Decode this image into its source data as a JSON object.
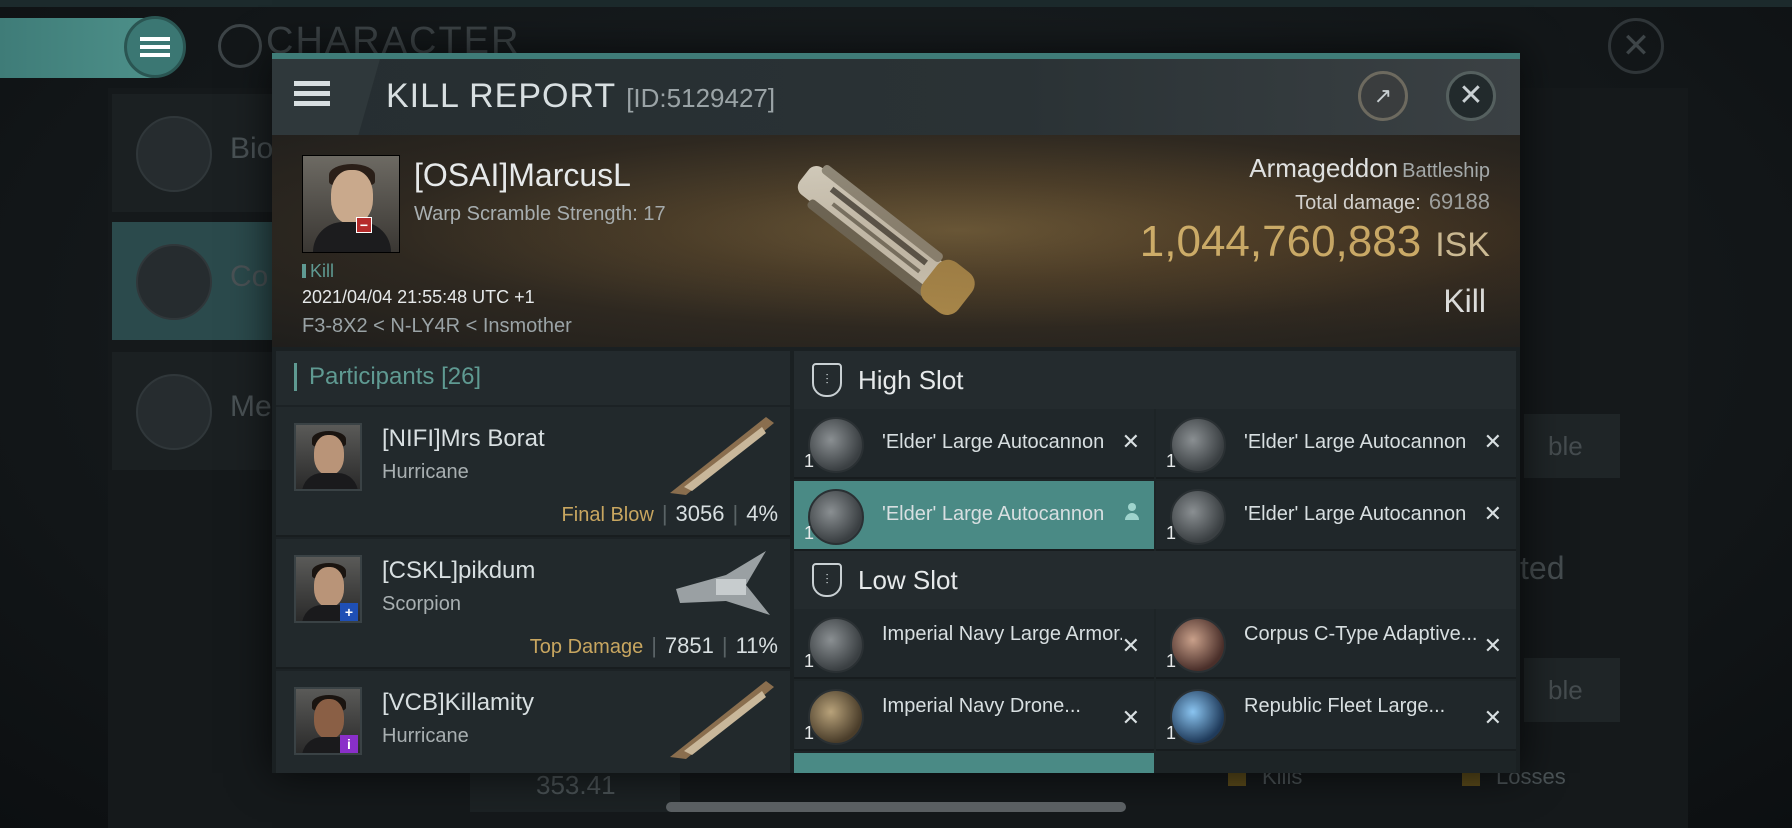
{
  "background": {
    "title": "CHARACTER",
    "side_items": [
      {
        "label": "Bio"
      },
      {
        "label": "Co"
      },
      {
        "label": "Me"
      }
    ],
    "right_buttons": [
      "ble",
      "ble"
    ],
    "right_text": "ted",
    "bottom_value": "353.41",
    "legend": [
      "Kills",
      "Losses"
    ]
  },
  "dialog": {
    "title": "KILL REPORT",
    "report_id": "[ID:5129427]"
  },
  "victim": {
    "name": "[OSAI]MarcusL",
    "subtitle": "Warp Scramble Strength: 17",
    "tag": "Kill",
    "timestamp": "2021/04/04 21:55:48 UTC +1",
    "location": "F3-8X2 < N-LY4R < Insmother",
    "ship_name": "Armageddon",
    "ship_class": "Battleship",
    "total_damage_label": "Total damage:",
    "total_damage": "69188",
    "isk_value": "1,044,760,883",
    "isk_unit": "ISK",
    "result": "Kill"
  },
  "participants": {
    "title": "Participants",
    "count": "[26]",
    "rows": [
      {
        "name": "[NIFI]Mrs Borat",
        "ship": "Hurricane",
        "label": "Final Blow",
        "damage": "3056",
        "percent": "4%",
        "badge": ""
      },
      {
        "name": "[CSKL]pikdum",
        "ship": "Scorpion",
        "label": "Top Damage",
        "damage": "7851",
        "percent": "11%",
        "badge": "+"
      },
      {
        "name": "[VCB]Killamity",
        "ship": "Hurricane",
        "label": "",
        "damage": "",
        "percent": "",
        "badge": "i"
      }
    ]
  },
  "slots": {
    "high_label": "High Slot",
    "low_label": "Low Slot",
    "high": [
      {
        "name": "'Elder' Large Autocannon",
        "qty": "1"
      },
      {
        "name": "'Elder' Large Autocannon",
        "qty": "1"
      },
      {
        "name": "'Elder' Large Autocannon",
        "qty": "1"
      },
      {
        "name": "'Elder' Large Autocannon",
        "qty": "1"
      }
    ],
    "low": [
      {
        "name": "Imperial Navy Large Armor...",
        "qty": "1"
      },
      {
        "name": "Corpus C-Type Adaptive...",
        "qty": "1"
      },
      {
        "name": "Imperial Navy Drone...",
        "qty": "1"
      },
      {
        "name": "Republic Fleet Large...",
        "qty": "1"
      }
    ]
  },
  "colors": {
    "accent": "#4f938c",
    "isk": "#e8c77a",
    "blow_label": "#c8a660",
    "selected_module": "#4a8a85"
  }
}
